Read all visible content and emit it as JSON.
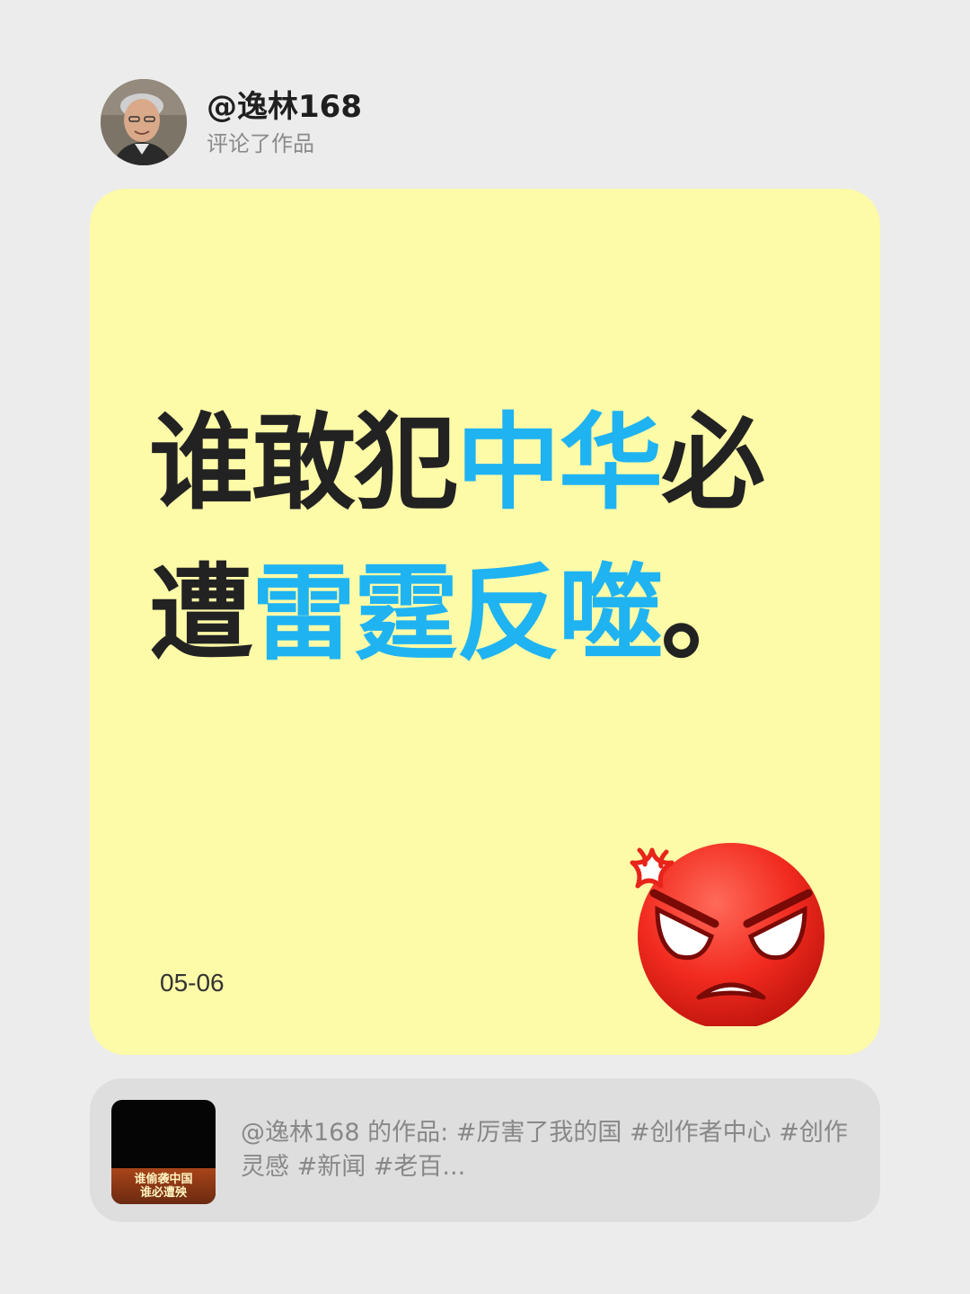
{
  "header": {
    "username": "@逸林168",
    "action": "评论了作品"
  },
  "card": {
    "line1": [
      "谁敢犯",
      "中华",
      "必"
    ],
    "line2": [
      "遭",
      "雷霆反噬",
      "。"
    ],
    "date": "05-06",
    "emoji": "angry-face-emoji",
    "colors": {
      "background": "#fdfaa8",
      "text": "#222222",
      "highlight": "#1fb3f2"
    }
  },
  "work": {
    "description": "@逸林168 的作品: #厉害了我的国 #创作者中心 #创作灵感 #新闻 #老百...",
    "thumbnail_text": [
      "谁偷袭中国",
      "谁必遭殃"
    ]
  }
}
